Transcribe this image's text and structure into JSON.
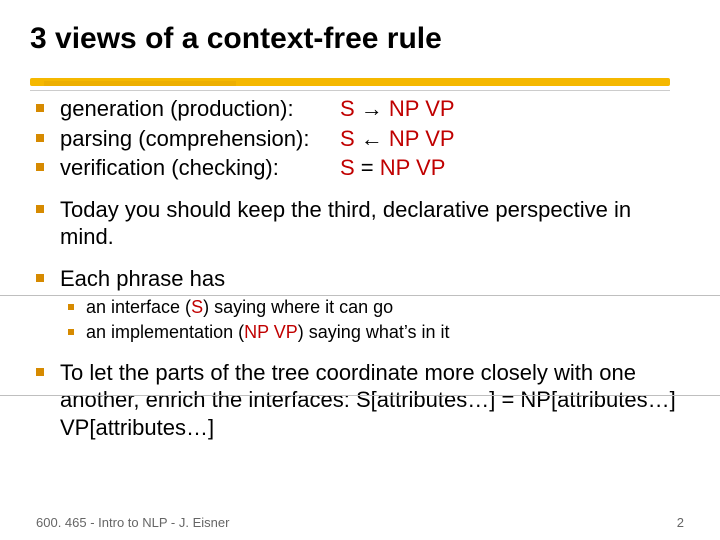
{
  "title": "3 views of a context-free rule",
  "items": {
    "a": {
      "label": "generation (production):",
      "lhs": "S",
      "arrow": " → ",
      "rhs": "NP VP"
    },
    "b": {
      "label": "parsing (comprehension):",
      "lhs": "S",
      "arrow": " ← ",
      "rhs": "NP VP"
    },
    "c": {
      "label": "verification (checking):",
      "lhs": "S",
      "arrow": " = ",
      "rhs": "NP VP"
    }
  },
  "today": "Today you should keep the third, declarative perspective in mind.",
  "each": "Each phrase has",
  "sub": {
    "iface_a": "an interface (",
    "iface_s": "S",
    "iface_b": ") saying where it can go",
    "impl_a": "an implementation (",
    "impl_np": "NP VP",
    "impl_b": ") saying what’s in it"
  },
  "last": "To let the parts of the tree coordinate more closely with one another, enrich the interfaces: S[attributes…] = NP[attributes…] VP[attributes…]",
  "footer": {
    "left": "600. 465 - Intro to NLP - J. Eisner",
    "right": "2"
  }
}
